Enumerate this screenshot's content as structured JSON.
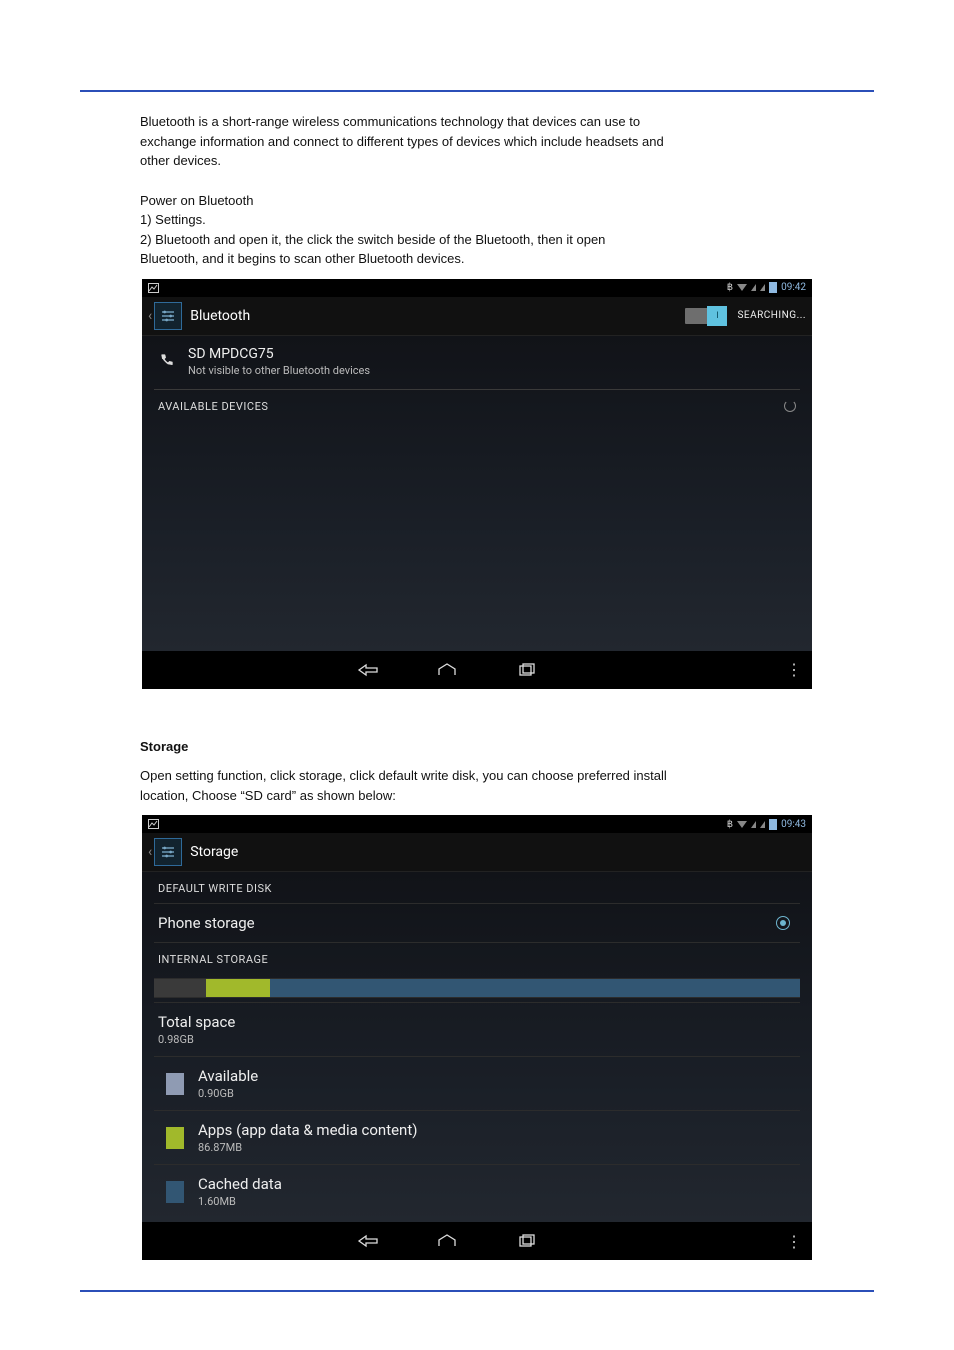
{
  "doc": {
    "intro1": "Bluetooth is a short-range wireless communications technology that devices can use to",
    "intro2": "exchange information and connect to different types of devices which include headsets and",
    "intro3": "other devices.",
    "bt_on_title": "Power on Bluetooth",
    "bt_on_step1": "1) Settings.",
    "bt_on_step2a": "2) Bluetooth and open it, the click the switch beside of the Bluetooth, then it open",
    "bt_on_step2b": "Bluetooth, and it begins to scan other Bluetooth devices.",
    "storage_title": "Storage",
    "storage_line1a": "Open setting function, click storage, click default write disk, you can choose preferred install",
    "storage_line1b": "location, Choose",
    "sdcard_quoted": "SD card",
    "storage_line1c": "as shown below:"
  },
  "shot1": {
    "status_time": "09:42",
    "ab_title": "Bluetooth",
    "toggle_on_label": "I",
    "searching": "SEARCHING...",
    "device_row_title": "SD MPDCG75",
    "device_row_sub": "Not visible to other Bluetooth devices",
    "available_header": "AVAILABLE DEVICES"
  },
  "shot2": {
    "status_time": "09:43",
    "ab_title": "Storage",
    "section_default": "DEFAULT WRITE DISK",
    "phone_storage": "Phone storage",
    "section_internal": "INTERNAL STORAGE",
    "total_title": "Total space",
    "total_sub": "0.98GB",
    "avail_title": "Available",
    "avail_sub": "0.90GB",
    "apps_title": "Apps (app data & media content)",
    "apps_sub": "86.87MB",
    "cached_title": "Cached data",
    "cached_sub": "1.60MB",
    "colors": {
      "avail": "#8f9bb3",
      "apps": "#a1b92b",
      "cached": "#325673"
    }
  }
}
